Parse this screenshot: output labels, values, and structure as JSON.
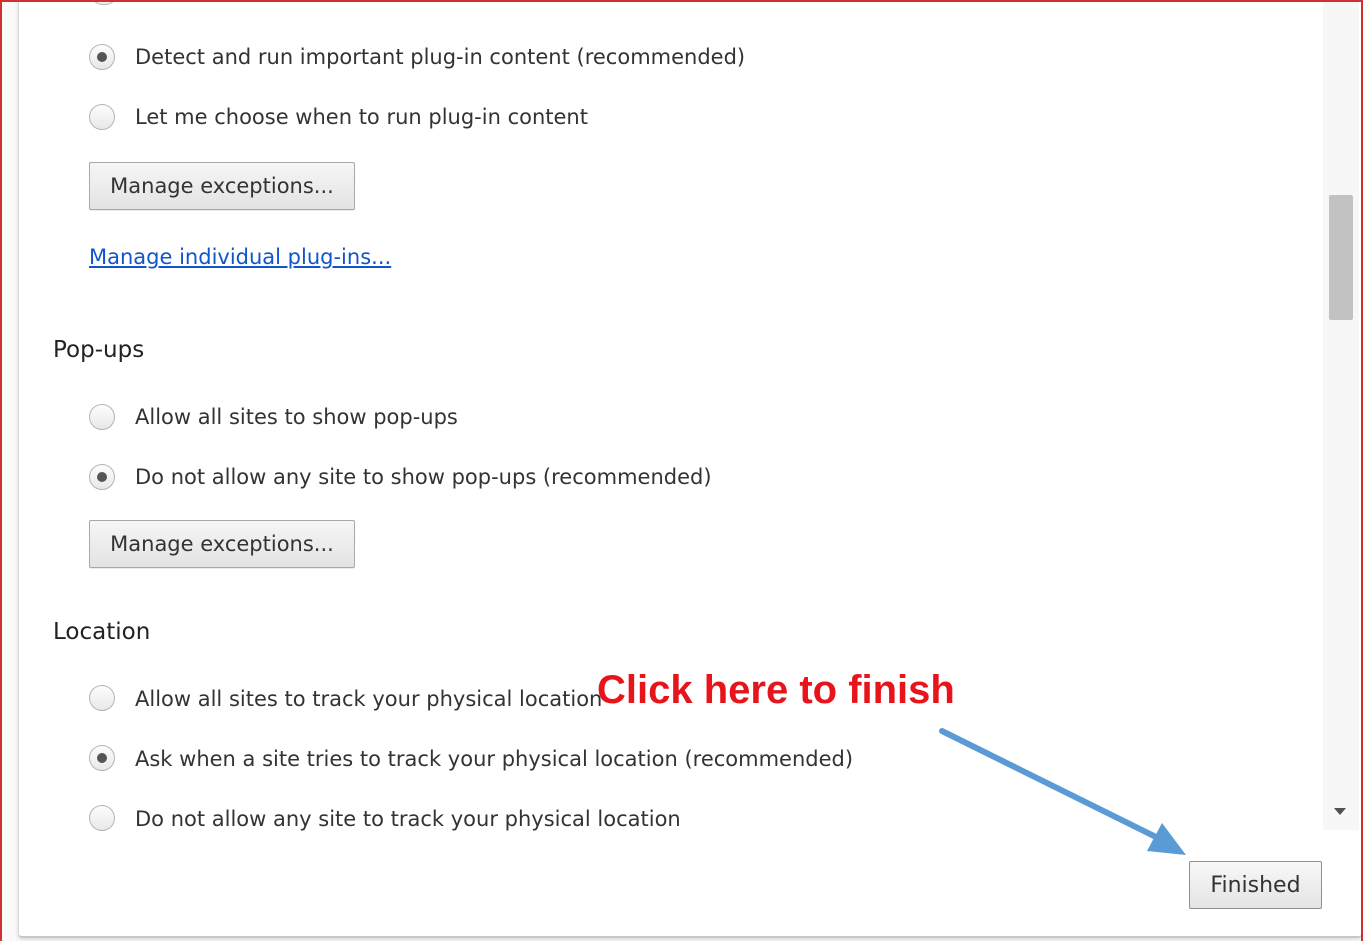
{
  "plugins": {
    "options": [
      {
        "label": "Detect and run important plug-in content (recommended)",
        "checked": true
      },
      {
        "label": "Let me choose when to run plug-in content",
        "checked": false
      }
    ],
    "manage_exceptions_label": "Manage exceptions...",
    "manage_plugins_link": "Manage individual plug-ins..."
  },
  "popups": {
    "heading": "Pop-ups",
    "options": [
      {
        "label": "Allow all sites to show pop-ups",
        "checked": false
      },
      {
        "label": "Do not allow any site to show pop-ups (recommended)",
        "checked": true
      }
    ],
    "manage_exceptions_label": "Manage exceptions..."
  },
  "location": {
    "heading": "Location",
    "options": [
      {
        "label": "Allow all sites to track your physical location",
        "checked": false
      },
      {
        "label": "Ask when a site tries to track your physical location (recommended)",
        "checked": true
      },
      {
        "label": "Do not allow any site to track your physical location",
        "checked": false
      }
    ]
  },
  "footer": {
    "finished_label": "Finished"
  },
  "annotation": {
    "text": "Click here to finish",
    "text_color": "#e8141b",
    "arrow_color": "#5b9bd5"
  },
  "colors": {
    "frame_border": "#d32f2f",
    "link": "#1155cc"
  }
}
